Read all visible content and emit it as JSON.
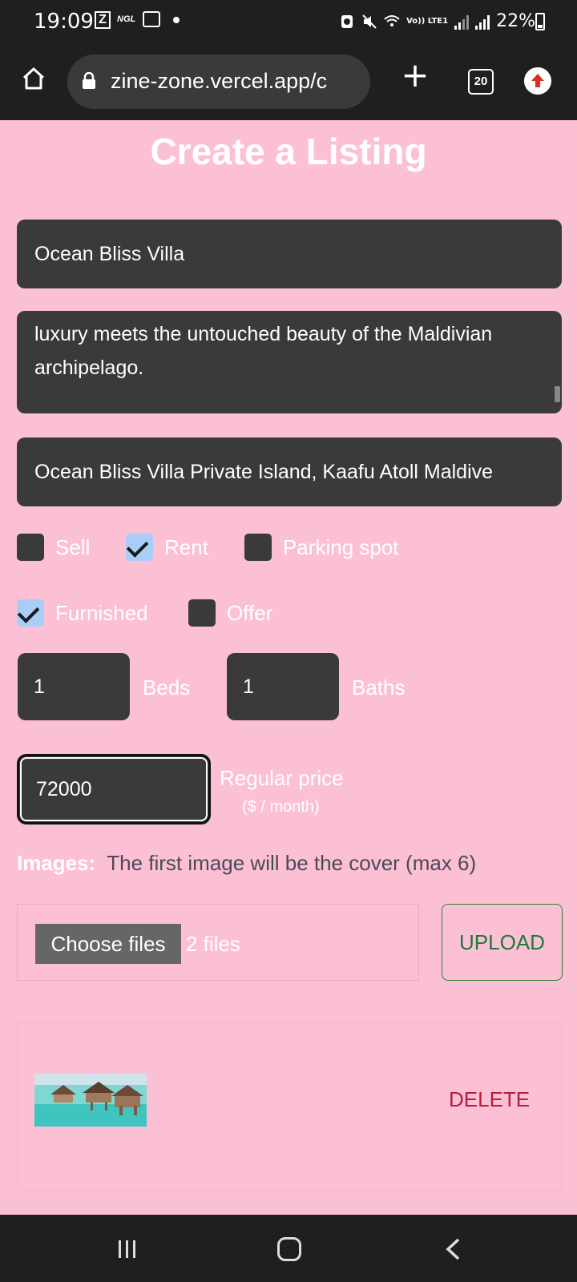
{
  "status_bar": {
    "time": "19:09",
    "notif_z": "Z",
    "notif_ngl": "NGL",
    "network": "Vo)) LTE1",
    "battery": "22%"
  },
  "browser": {
    "url": "zine-zone.vercel.app/c",
    "tab_count": "20"
  },
  "form": {
    "title": "Create a Listing",
    "name": "Ocean Bliss Villa",
    "description": "luxury meets the untouched beauty of the Maldivian archipelago.",
    "address": "Ocean Bliss Villa Private Island, Kaafu Atoll Maldive",
    "checkboxes": [
      {
        "label": "Sell",
        "checked": false
      },
      {
        "label": "Rent",
        "checked": true
      },
      {
        "label": "Parking spot",
        "checked": false
      },
      {
        "label": "Furnished",
        "checked": true
      },
      {
        "label": "Offer",
        "checked": false
      }
    ],
    "beds": "1",
    "beds_label": "Beds",
    "baths": "1",
    "baths_label": "Baths",
    "regular_price": "72000",
    "regular_price_label": "Regular price",
    "price_unit": "($ / month)",
    "images_label": "Images:",
    "images_hint": "The first image will be the cover (max 6)",
    "choose_files_label": "Choose files",
    "files_count": "2 files",
    "upload_label": "UPLOAD",
    "delete_label": "DELETE"
  },
  "colors": {
    "page_bg": "#fcc0d4",
    "field_bg": "#3a3a3a",
    "upload": "#1b7a3a",
    "delete": "#b71c3a",
    "checked": "#a8cdf7"
  }
}
